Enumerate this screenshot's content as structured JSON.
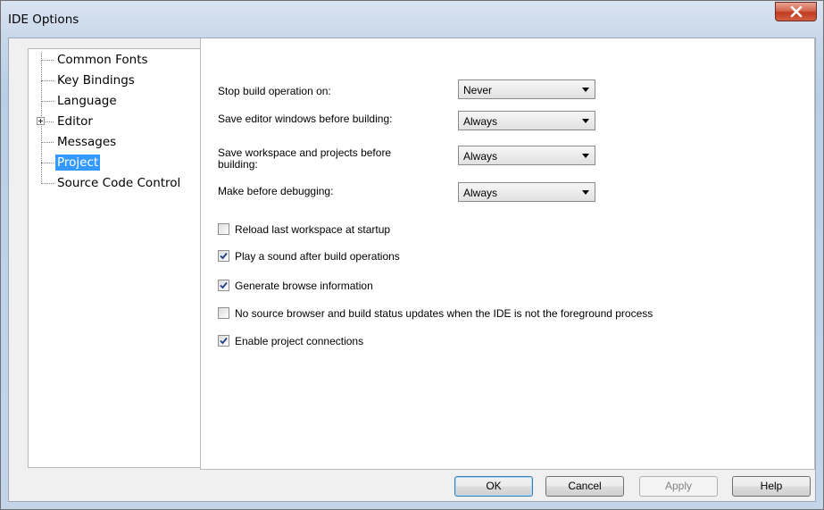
{
  "window": {
    "title": "IDE Options",
    "close_icon": "close-x-icon"
  },
  "tree": {
    "items": [
      {
        "label": "Common Fonts",
        "selected": false,
        "expandable": false
      },
      {
        "label": "Key Bindings",
        "selected": false,
        "expandable": false
      },
      {
        "label": "Language",
        "selected": false,
        "expandable": false
      },
      {
        "label": "Editor",
        "selected": false,
        "expandable": true
      },
      {
        "label": "Messages",
        "selected": false,
        "expandable": false
      },
      {
        "label": "Project",
        "selected": true,
        "expandable": false
      },
      {
        "label": "Source Code Control",
        "selected": false,
        "expandable": false
      }
    ]
  },
  "settings": {
    "stop_build": {
      "label": "Stop build operation on:",
      "value": "Never"
    },
    "save_editor": {
      "label": "Save editor windows before building:",
      "value": "Always"
    },
    "save_workspace": {
      "label_line1": "Save workspace and projects before",
      "label_line2": "building:",
      "value": "Always"
    },
    "make_before_debug": {
      "label": "Make before debugging:",
      "value": "Always"
    }
  },
  "checkboxes": [
    {
      "label": "Reload last workspace at startup",
      "checked": false
    },
    {
      "label": "Play a sound after build operations",
      "checked": true
    },
    {
      "label": "Generate browse information",
      "checked": true
    },
    {
      "label": "No source browser and build status updates when the IDE is not the foreground process",
      "checked": false
    },
    {
      "label": "Enable project connections",
      "checked": true
    }
  ],
  "buttons": {
    "ok": "OK",
    "cancel": "Cancel",
    "apply": "Apply",
    "help": "Help"
  },
  "colors": {
    "selection": "#3399ff",
    "close_button": "#c23a22"
  }
}
